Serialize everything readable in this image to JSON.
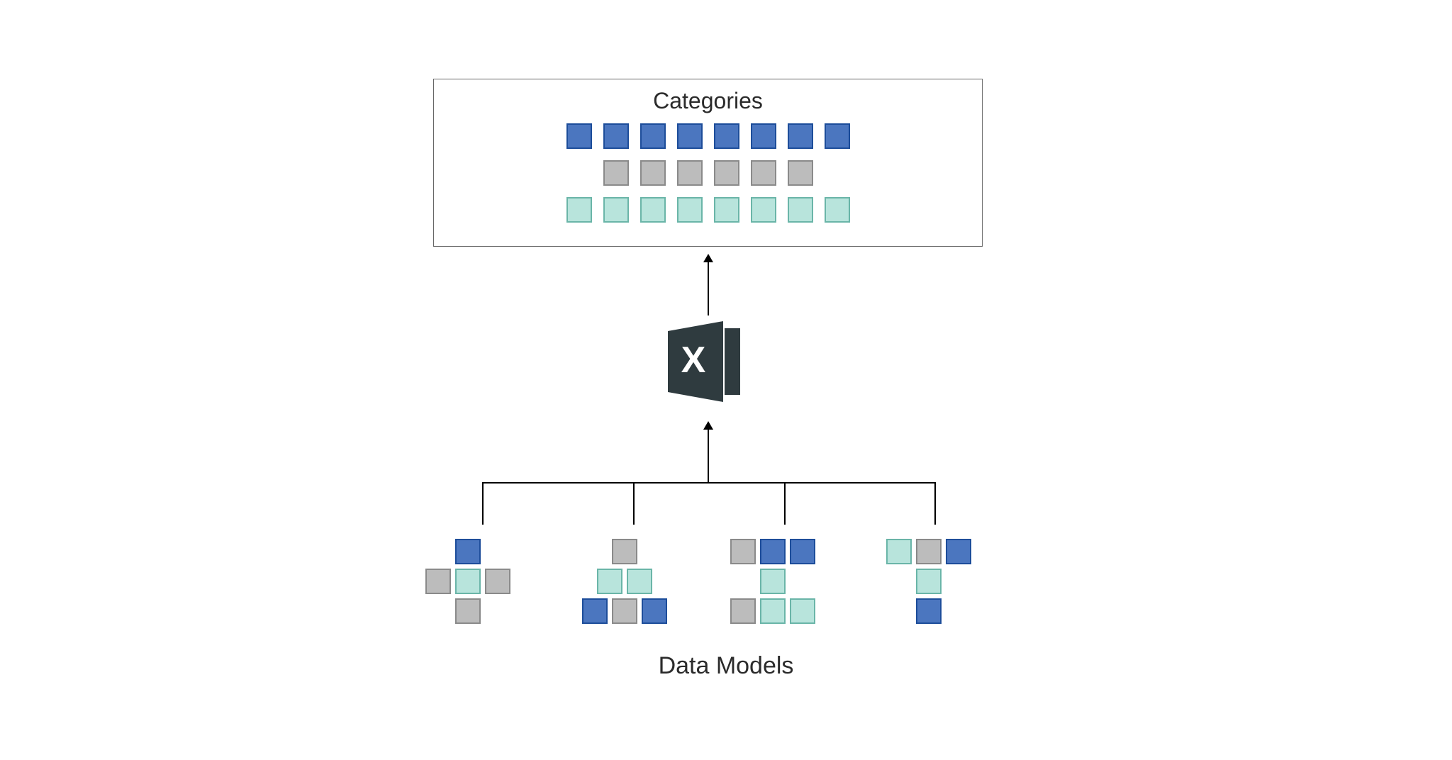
{
  "labels": {
    "categories": "Categories",
    "dataModels": "Data Models"
  },
  "icon": {
    "letter": "X"
  },
  "colors": {
    "blue_fill": "#4b76bf",
    "blue_border": "#1d4d9a",
    "gray_fill": "#bcbcbc",
    "gray_border": "#8a8a8a",
    "teal_fill": "#b8e4dc",
    "teal_border": "#6ab5a8",
    "icon_dark": "#2f3b3f"
  },
  "category_rows": [
    {
      "color": "blue",
      "count": 8
    },
    {
      "color": "gray",
      "count": 6
    },
    {
      "color": "teal",
      "count": 8
    }
  ],
  "data_models": [
    {
      "id": "plus",
      "squares": [
        {
          "r": 0,
          "c": 1,
          "color": "blue"
        },
        {
          "r": 1,
          "c": 0,
          "color": "gray"
        },
        {
          "r": 1,
          "c": 1,
          "color": "teal"
        },
        {
          "r": 1,
          "c": 2,
          "color": "gray"
        },
        {
          "r": 2,
          "c": 1,
          "color": "gray"
        }
      ]
    },
    {
      "id": "triangle",
      "squares": [
        {
          "r": 0,
          "c": 1.5,
          "color": "gray"
        },
        {
          "r": 1,
          "c": 1,
          "color": "teal"
        },
        {
          "r": 1,
          "c": 2,
          "color": "teal"
        },
        {
          "r": 2,
          "c": 0.5,
          "color": "blue"
        },
        {
          "r": 2,
          "c": 1.5,
          "color": "gray"
        },
        {
          "r": 2,
          "c": 2.5,
          "color": "blue"
        }
      ]
    },
    {
      "id": "i-shape",
      "squares": [
        {
          "r": 0,
          "c": 0,
          "color": "gray"
        },
        {
          "r": 0,
          "c": 1,
          "color": "blue"
        },
        {
          "r": 0,
          "c": 2,
          "color": "blue"
        },
        {
          "r": 1,
          "c": 1,
          "color": "teal"
        },
        {
          "r": 2,
          "c": 0,
          "color": "gray"
        },
        {
          "r": 2,
          "c": 1,
          "color": "teal"
        },
        {
          "r": 2,
          "c": 2,
          "color": "teal"
        }
      ]
    },
    {
      "id": "t-shape",
      "squares": [
        {
          "r": 0,
          "c": 0,
          "color": "teal"
        },
        {
          "r": 0,
          "c": 1,
          "color": "gray"
        },
        {
          "r": 0,
          "c": 2,
          "color": "blue"
        },
        {
          "r": 1,
          "c": 1,
          "color": "teal"
        },
        {
          "r": 2,
          "c": 1,
          "color": "blue"
        }
      ]
    }
  ]
}
